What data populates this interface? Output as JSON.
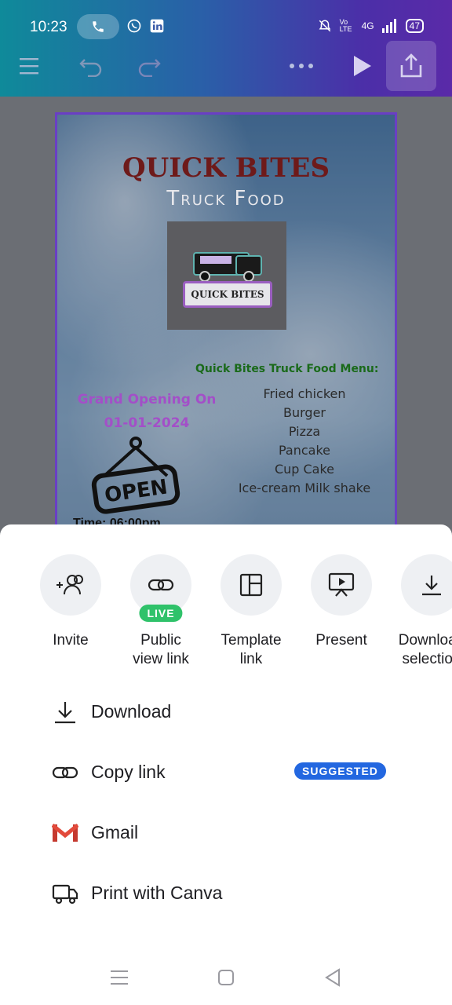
{
  "status_bar": {
    "time": "10:23",
    "network": "4G",
    "volte": "Vo LTE",
    "battery": "47"
  },
  "poster": {
    "title": "QUICK BITES",
    "subtitle": "Truck Food",
    "logo_text": "QUICK BITES",
    "menu_title": "Quick Bites Truck Food Menu:",
    "menu_items": [
      "Fried chicken",
      "Burger",
      "Pizza",
      "Pancake",
      "Cup Cake",
      "Ice-cream Milk shake"
    ],
    "grand_opening": "Grand Opening On",
    "date": "01-01-2024",
    "open_sign": "OPEN",
    "time_label": "Time: 06:00pm"
  },
  "share_options": [
    {
      "label": "Invite",
      "icon": "invite-icon"
    },
    {
      "label": "Public\nview link",
      "icon": "link-icon",
      "badge": "LIVE"
    },
    {
      "label": "Template\nlink",
      "icon": "template-icon"
    },
    {
      "label": "Present",
      "icon": "present-icon"
    },
    {
      "label": "Download\nselection",
      "icon": "download-icon"
    }
  ],
  "actions": [
    {
      "label": "Download",
      "icon": "download-icon"
    },
    {
      "label": "Copy link",
      "icon": "link-icon",
      "badge": "SUGGESTED"
    },
    {
      "label": "Gmail",
      "icon": "gmail-icon"
    },
    {
      "label": "Print with Canva",
      "icon": "truck-icon"
    }
  ],
  "colors": {
    "live_badge": "#2fc26a",
    "suggested_badge": "#2367e0",
    "poster_border": "#6a3fc4"
  }
}
